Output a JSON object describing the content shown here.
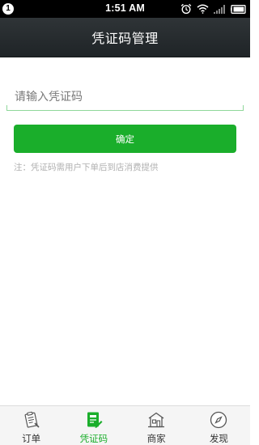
{
  "status_bar": {
    "notification_count": "1",
    "time": "1:51 AM"
  },
  "header": {
    "title": "凭证码管理"
  },
  "form": {
    "code_placeholder": "请输入凭证码",
    "code_value": "",
    "confirm_label": "确定",
    "note": "注：凭证码需用户下单后到店消费提供"
  },
  "tabs": [
    {
      "label": "订单",
      "icon": "order-list-icon",
      "active": false
    },
    {
      "label": "凭证码",
      "icon": "voucher-code-icon",
      "active": true
    },
    {
      "label": "商家",
      "icon": "shop-icon",
      "active": false
    },
    {
      "label": "发现",
      "icon": "compass-icon",
      "active": false
    }
  ],
  "colors": {
    "accent": "#1aae2b",
    "title_bar": "#262b2e",
    "tab_bar": "#f5f5f5"
  }
}
